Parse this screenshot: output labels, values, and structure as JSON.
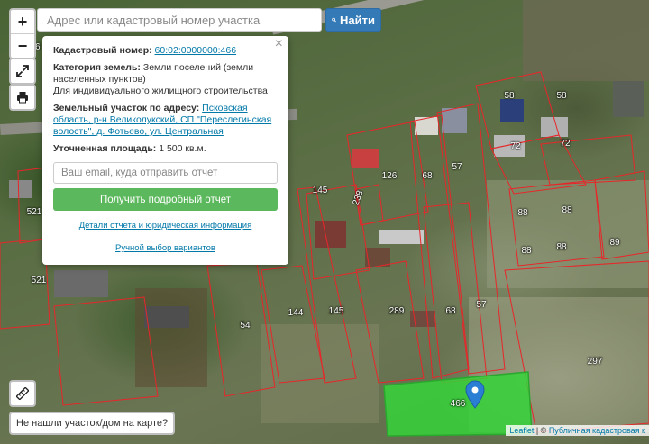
{
  "search": {
    "placeholder": "Адрес или кадастровый номер участка",
    "button_label": "Найти"
  },
  "controls": {
    "zoom_in": "+",
    "zoom_out": "−"
  },
  "popup": {
    "close": "×",
    "cadastral_label": "Кадастровый номер:",
    "cadastral_value": "60:02:0000000:466",
    "category_label": "Категория земель:",
    "category_value": "Земли поселений (земли населенных пунктов)",
    "use_value": "Для индивидуального жилищного строительства",
    "address_label": "Земельный участок по адресу:",
    "address_value": "Псковская область, р-н Великолукский, СП \"Переслегинская волость\", д. Фотьево, ул. Центральная",
    "area_label": "Уточненная площадь:",
    "area_value": "1 500 кв.м.",
    "email_placeholder": "Ваш email, куда отправить отчет",
    "report_button": "Получить подробный отчет",
    "details_link": "Детали отчета и юридическая информация",
    "manual_link": "Ручной выбор вариантов"
  },
  "not_found_button": "Не нашли участок/дом на карте?",
  "attribution": {
    "leaflet": "Leaflet",
    "separator": " | © ",
    "source": "Публичная кадастровая к"
  },
  "plot_labels": [
    {
      "text": "58"
    },
    {
      "text": "58"
    },
    {
      "text": "72"
    },
    {
      "text": "72"
    },
    {
      "text": "126"
    },
    {
      "text": "68"
    },
    {
      "text": "57"
    },
    {
      "text": "145"
    },
    {
      "text": "238"
    },
    {
      "text": "88"
    },
    {
      "text": "88"
    },
    {
      "text": "88"
    },
    {
      "text": "88"
    },
    {
      "text": "89"
    },
    {
      "text": "521"
    },
    {
      "text": "521"
    },
    {
      "text": "54"
    },
    {
      "text": "144"
    },
    {
      "text": "145"
    },
    {
      "text": "289"
    },
    {
      "text": "68"
    },
    {
      "text": "57"
    },
    {
      "text": "297"
    },
    {
      "text": "466"
    },
    {
      "text": "96"
    }
  ],
  "colors": {
    "plot_outline": "#e8262a",
    "selected_plot": "#35d43a",
    "button_blue": "#337ab7",
    "button_green": "#5cb85c",
    "link": "#0078a8"
  },
  "icons": {
    "search": "magnifier",
    "fullscreen": "expand-arrows",
    "print": "printer",
    "ruler": "ruler",
    "pin": "map-marker"
  }
}
